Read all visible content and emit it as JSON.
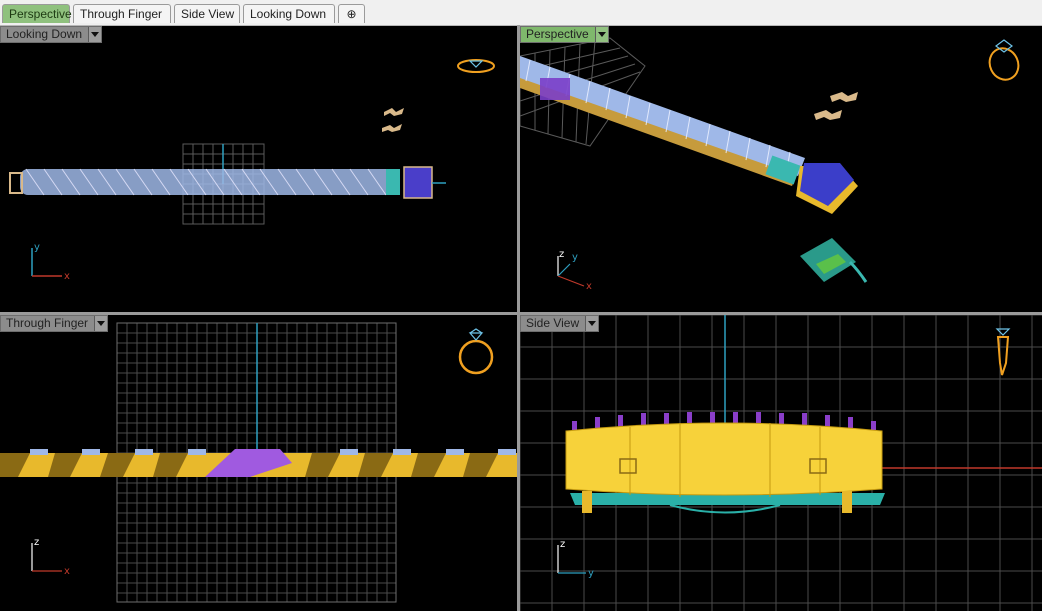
{
  "tabs": [
    {
      "label": "Perspective",
      "active": true
    },
    {
      "label": "Through Finger",
      "active": false
    },
    {
      "label": "Side View",
      "active": false
    },
    {
      "label": "Looking Down",
      "active": false
    }
  ],
  "add_tab_symbol": "⊕",
  "viewports": {
    "top_left": {
      "label": "Looking Down",
      "active": false,
      "axes": [
        "x",
        "y"
      ]
    },
    "top_right": {
      "label": "Perspective",
      "active": true,
      "axes": [
        "x",
        "y",
        "z"
      ]
    },
    "bottom_left": {
      "label": "Through Finger",
      "active": false,
      "axes": [
        "x",
        "z"
      ]
    },
    "bottom_right": {
      "label": "Side View",
      "active": false,
      "axes": [
        "y",
        "z"
      ]
    }
  },
  "icons": {
    "view_cube": "ring-orientation-icon",
    "dropdown": "chevron-down-icon"
  },
  "colors": {
    "viewport_bg": "#000000",
    "grid": "#6e6e6e",
    "gold": "#e8b92c",
    "stone": "#9fb8e8",
    "active_tab": "#8fc17e",
    "axis_x": "#c0392b",
    "axis_y": "#2ea0c0",
    "axis_z": "#ffffff",
    "ring_icon": "#f0a020"
  }
}
